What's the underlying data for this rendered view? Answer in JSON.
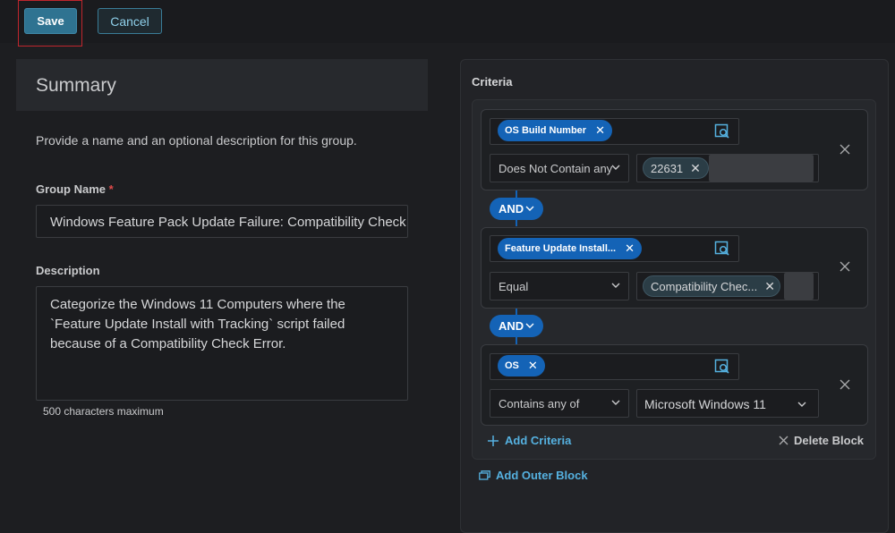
{
  "toolbar": {
    "save_label": "Save",
    "cancel_label": "Cancel"
  },
  "summary": {
    "title": "Summary",
    "description": "Provide a name and an optional description for this group.",
    "group_name_label": "Group Name",
    "required_marker": "*",
    "group_name_value": "Windows Feature Pack Update Failure: Compatibility Check Error",
    "description_label": "Description",
    "description_value": "Categorize the Windows 11 Computers where the `Feature Update Install with Tracking` script failed because of a Compatibility Check Error.",
    "char_limit": "500 characters maximum"
  },
  "criteria": {
    "title": "Criteria",
    "blocks": [
      {
        "field": "OS Build Number",
        "operator": "Does Not Contain any",
        "value": "22631"
      },
      {
        "field": "Feature Update Install...",
        "operator": "Equal",
        "value": "Compatibility Chec..."
      },
      {
        "field": "OS",
        "operator": "Contains any of",
        "value": "Microsoft Windows 11"
      }
    ],
    "conjunctions": [
      "AND",
      "AND"
    ],
    "add_criteria_label": "Add Criteria",
    "delete_block_label": "Delete Block",
    "add_outer_block_label": "Add Outer Block"
  },
  "colors": {
    "accent": "#1463b6",
    "link": "#55b1e0",
    "save": "#2f7391",
    "required": "#e04b4b"
  }
}
